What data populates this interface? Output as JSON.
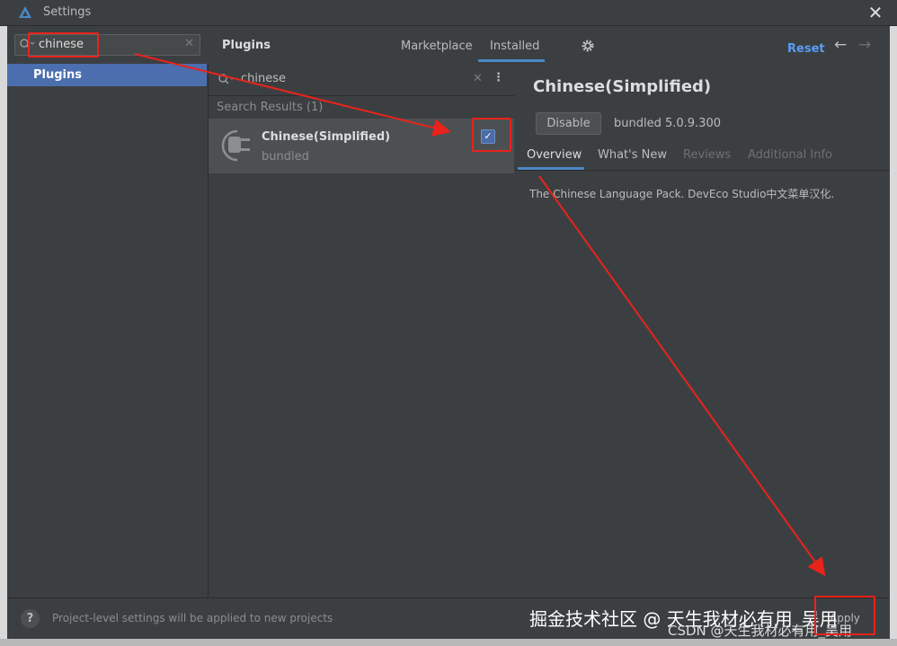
{
  "window": {
    "title": "Settings"
  },
  "left": {
    "search_value": "chinese",
    "nav": [
      {
        "label": "Plugins"
      }
    ]
  },
  "header": {
    "title": "Plugins",
    "tabs": [
      {
        "label": "Marketplace"
      },
      {
        "label": "Installed"
      }
    ],
    "reset_label": "Reset"
  },
  "middle": {
    "search_value": "chinese",
    "results_label": "Search Results (1)",
    "results": [
      {
        "name": "Chinese(Simplified)",
        "subtitle": "bundled",
        "enabled": true
      }
    ]
  },
  "detail": {
    "title": "Chinese(Simplified)",
    "button_label": "Disable",
    "version": "bundled 5.0.9.300",
    "tabs": [
      {
        "label": "Overview"
      },
      {
        "label": "What's New"
      },
      {
        "label": "Reviews"
      },
      {
        "label": "Additional Info"
      }
    ],
    "description": "The Chinese Language Pack. DevEco Studio中文菜单汉化."
  },
  "status": {
    "help": "?",
    "text": "Project-level settings will be applied to new projects",
    "apply_hint": "Apply"
  },
  "watermark": {
    "line1": "掘金技术社区 @ 天生我材必有用_吴用",
    "line2": "CSDN @天生我材必有用_吴用"
  },
  "colors": {
    "accent": "#4a88c7",
    "selection": "#4b6eaf",
    "annotation": "#e8231c"
  },
  "icons": [
    "app-logo-icon",
    "search-icon",
    "close-icon",
    "clear-icon",
    "gear-icon",
    "arrow-left-icon",
    "arrow-right-icon",
    "more-icon",
    "plugin-icon",
    "checkbox-icon",
    "help-icon"
  ]
}
